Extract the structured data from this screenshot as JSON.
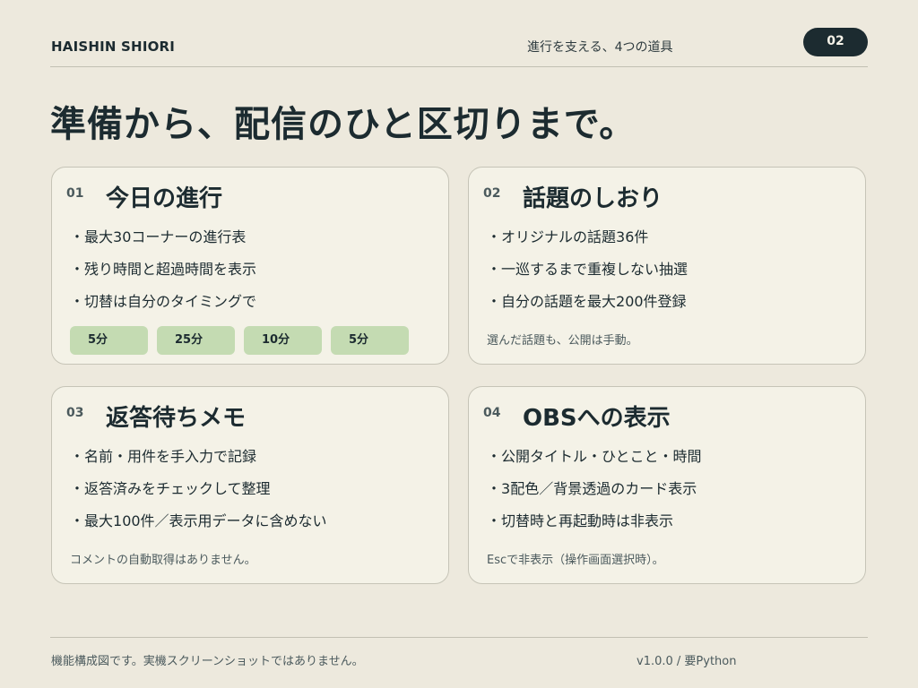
{
  "header": {
    "brand": "HAISHIN SHIORI",
    "tagline": "進行を支える、4つの道具",
    "page_number": "02"
  },
  "headline": "準備から、配信のひと区切りまで。",
  "cards": [
    {
      "number": "01",
      "title": "今日の進行",
      "items": [
        "最大30コーナーの進行表",
        "残り時間と超過時間を表示",
        "切替は自分のタイミングで"
      ],
      "chips": [
        "5分",
        "25分",
        "10分",
        "5分"
      ]
    },
    {
      "number": "02",
      "title": "話題のしおり",
      "items": [
        "オリジナルの話題36件",
        "一巡するまで重複しない抽選",
        "自分の話題を最大200件登録"
      ],
      "note": "選んだ話題も、公開は手動。"
    },
    {
      "number": "03",
      "title": "返答待ちメモ",
      "items": [
        "名前・用件を手入力で記録",
        "返答済みをチェックして整理",
        "最大100件／表示用データに含めない"
      ],
      "note": "コメントの自動取得はありません。"
    },
    {
      "number": "04",
      "title": "OBSへの表示",
      "items": [
        "公開タイトル・ひとこと・時間",
        "3配色／背景透過のカード表示",
        "切替時と再起動時は非表示"
      ],
      "note": "Escで非表示（操作画面選択時）。"
    }
  ],
  "footer": {
    "note": "機能構成図です。実機スクリーンショットではありません。",
    "version": "v1.0.0 / 要Python"
  },
  "colors": {
    "background": "#ede9dd",
    "card": "#f4f2e7",
    "ink": "#1c2b30",
    "chip": "#c4dbb2"
  }
}
